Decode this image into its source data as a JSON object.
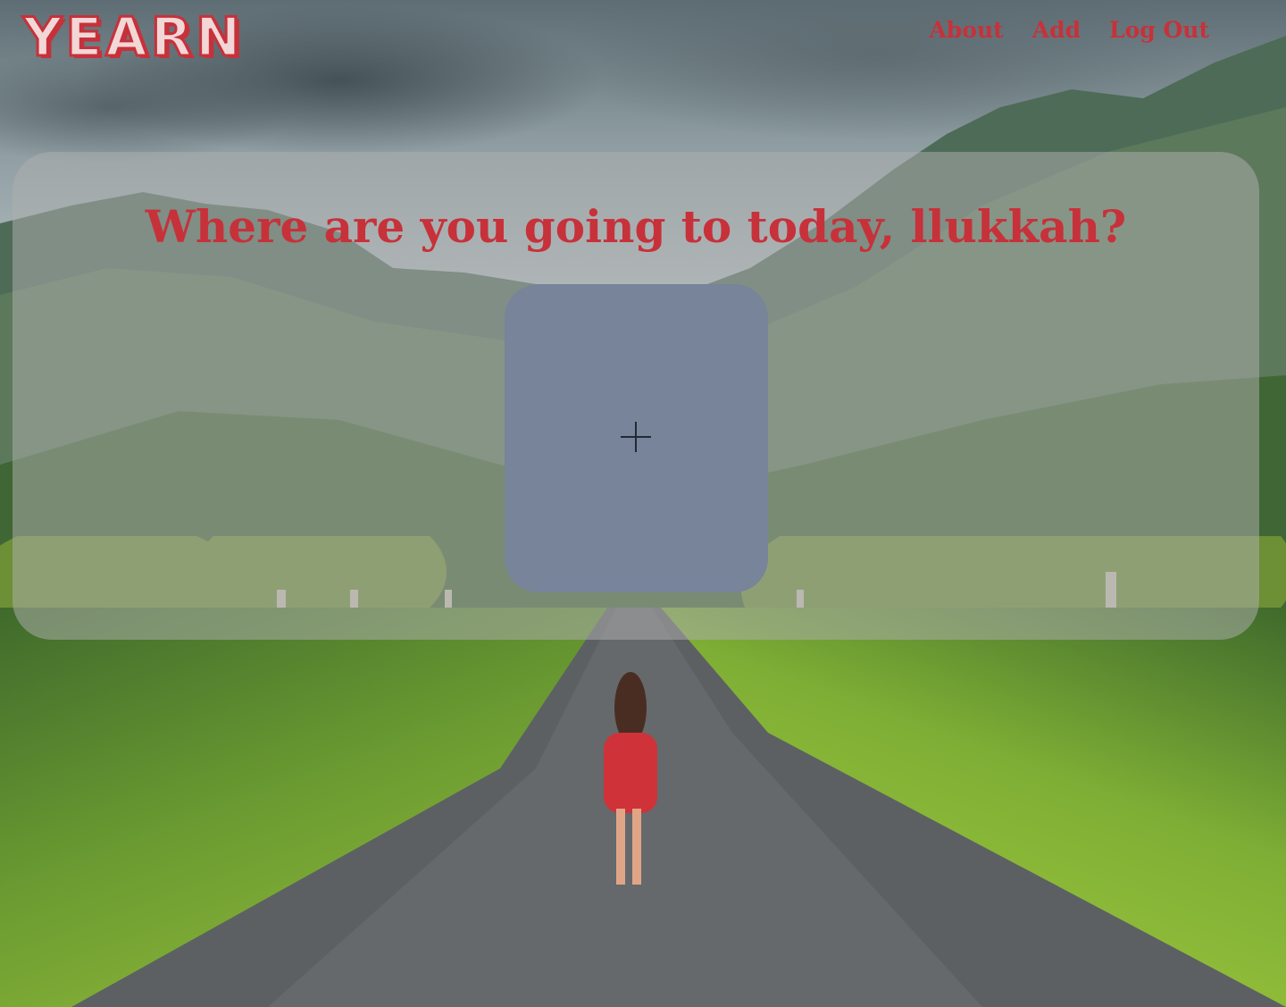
{
  "header": {
    "logo_text": "YEARN",
    "nav": [
      {
        "label": "About"
      },
      {
        "label": "Add"
      },
      {
        "label": "Log Out"
      }
    ]
  },
  "main": {
    "headline": "Where are you going to today, llukkah?",
    "add_tile": {
      "icon": "plus-icon"
    }
  },
  "theme": {
    "accent": "#c7313a",
    "panel_overlay": "rgba(175,175,175,0.52)",
    "tile": "#77849a"
  }
}
